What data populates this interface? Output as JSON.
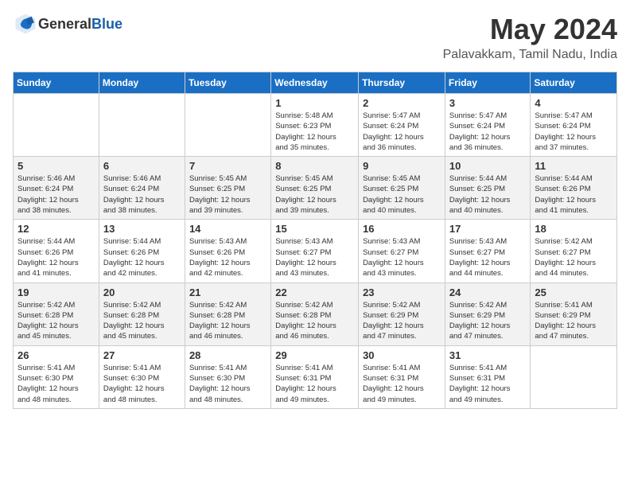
{
  "header": {
    "logo_general": "General",
    "logo_blue": "Blue",
    "month_year": "May 2024",
    "location": "Palavakkam, Tamil Nadu, India"
  },
  "weekdays": [
    "Sunday",
    "Monday",
    "Tuesday",
    "Wednesday",
    "Thursday",
    "Friday",
    "Saturday"
  ],
  "weeks": [
    [
      {
        "day": "",
        "content": ""
      },
      {
        "day": "",
        "content": ""
      },
      {
        "day": "",
        "content": ""
      },
      {
        "day": "1",
        "content": "Sunrise: 5:48 AM\nSunset: 6:23 PM\nDaylight: 12 hours\nand 35 minutes."
      },
      {
        "day": "2",
        "content": "Sunrise: 5:47 AM\nSunset: 6:24 PM\nDaylight: 12 hours\nand 36 minutes."
      },
      {
        "day": "3",
        "content": "Sunrise: 5:47 AM\nSunset: 6:24 PM\nDaylight: 12 hours\nand 36 minutes."
      },
      {
        "day": "4",
        "content": "Sunrise: 5:47 AM\nSunset: 6:24 PM\nDaylight: 12 hours\nand 37 minutes."
      }
    ],
    [
      {
        "day": "5",
        "content": "Sunrise: 5:46 AM\nSunset: 6:24 PM\nDaylight: 12 hours\nand 38 minutes."
      },
      {
        "day": "6",
        "content": "Sunrise: 5:46 AM\nSunset: 6:24 PM\nDaylight: 12 hours\nand 38 minutes."
      },
      {
        "day": "7",
        "content": "Sunrise: 5:45 AM\nSunset: 6:25 PM\nDaylight: 12 hours\nand 39 minutes."
      },
      {
        "day": "8",
        "content": "Sunrise: 5:45 AM\nSunset: 6:25 PM\nDaylight: 12 hours\nand 39 minutes."
      },
      {
        "day": "9",
        "content": "Sunrise: 5:45 AM\nSunset: 6:25 PM\nDaylight: 12 hours\nand 40 minutes."
      },
      {
        "day": "10",
        "content": "Sunrise: 5:44 AM\nSunset: 6:25 PM\nDaylight: 12 hours\nand 40 minutes."
      },
      {
        "day": "11",
        "content": "Sunrise: 5:44 AM\nSunset: 6:26 PM\nDaylight: 12 hours\nand 41 minutes."
      }
    ],
    [
      {
        "day": "12",
        "content": "Sunrise: 5:44 AM\nSunset: 6:26 PM\nDaylight: 12 hours\nand 41 minutes."
      },
      {
        "day": "13",
        "content": "Sunrise: 5:44 AM\nSunset: 6:26 PM\nDaylight: 12 hours\nand 42 minutes."
      },
      {
        "day": "14",
        "content": "Sunrise: 5:43 AM\nSunset: 6:26 PM\nDaylight: 12 hours\nand 42 minutes."
      },
      {
        "day": "15",
        "content": "Sunrise: 5:43 AM\nSunset: 6:27 PM\nDaylight: 12 hours\nand 43 minutes."
      },
      {
        "day": "16",
        "content": "Sunrise: 5:43 AM\nSunset: 6:27 PM\nDaylight: 12 hours\nand 43 minutes."
      },
      {
        "day": "17",
        "content": "Sunrise: 5:43 AM\nSunset: 6:27 PM\nDaylight: 12 hours\nand 44 minutes."
      },
      {
        "day": "18",
        "content": "Sunrise: 5:42 AM\nSunset: 6:27 PM\nDaylight: 12 hours\nand 44 minutes."
      }
    ],
    [
      {
        "day": "19",
        "content": "Sunrise: 5:42 AM\nSunset: 6:28 PM\nDaylight: 12 hours\nand 45 minutes."
      },
      {
        "day": "20",
        "content": "Sunrise: 5:42 AM\nSunset: 6:28 PM\nDaylight: 12 hours\nand 45 minutes."
      },
      {
        "day": "21",
        "content": "Sunrise: 5:42 AM\nSunset: 6:28 PM\nDaylight: 12 hours\nand 46 minutes."
      },
      {
        "day": "22",
        "content": "Sunrise: 5:42 AM\nSunset: 6:28 PM\nDaylight: 12 hours\nand 46 minutes."
      },
      {
        "day": "23",
        "content": "Sunrise: 5:42 AM\nSunset: 6:29 PM\nDaylight: 12 hours\nand 47 minutes."
      },
      {
        "day": "24",
        "content": "Sunrise: 5:42 AM\nSunset: 6:29 PM\nDaylight: 12 hours\nand 47 minutes."
      },
      {
        "day": "25",
        "content": "Sunrise: 5:41 AM\nSunset: 6:29 PM\nDaylight: 12 hours\nand 47 minutes."
      }
    ],
    [
      {
        "day": "26",
        "content": "Sunrise: 5:41 AM\nSunset: 6:30 PM\nDaylight: 12 hours\nand 48 minutes."
      },
      {
        "day": "27",
        "content": "Sunrise: 5:41 AM\nSunset: 6:30 PM\nDaylight: 12 hours\nand 48 minutes."
      },
      {
        "day": "28",
        "content": "Sunrise: 5:41 AM\nSunset: 6:30 PM\nDaylight: 12 hours\nand 48 minutes."
      },
      {
        "day": "29",
        "content": "Sunrise: 5:41 AM\nSunset: 6:31 PM\nDaylight: 12 hours\nand 49 minutes."
      },
      {
        "day": "30",
        "content": "Sunrise: 5:41 AM\nSunset: 6:31 PM\nDaylight: 12 hours\nand 49 minutes."
      },
      {
        "day": "31",
        "content": "Sunrise: 5:41 AM\nSunset: 6:31 PM\nDaylight: 12 hours\nand 49 minutes."
      },
      {
        "day": "",
        "content": ""
      }
    ]
  ]
}
